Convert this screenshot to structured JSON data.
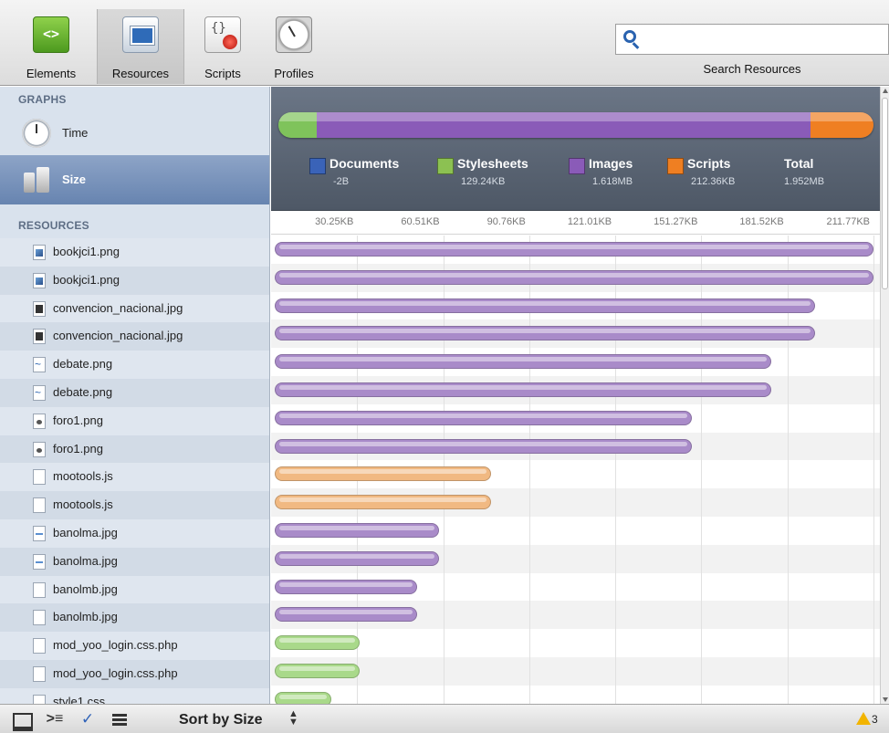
{
  "toolbar": {
    "items": [
      {
        "label": "Elements",
        "icon": "elements-icon"
      },
      {
        "label": "Resources",
        "icon": "resources-icon",
        "selected": true
      },
      {
        "label": "Scripts",
        "icon": "scripts-icon"
      },
      {
        "label": "Profiles",
        "icon": "profiles-icon"
      }
    ],
    "search_label": "Search Resources",
    "search_value": ""
  },
  "sidebar": {
    "graphs_title": "GRAPHS",
    "graphs": [
      {
        "label": "Time",
        "icon": "clock-icon"
      },
      {
        "label": "Size",
        "icon": "weights-icon",
        "selected": true
      }
    ],
    "resources_title": "RESOURCES",
    "resources": [
      {
        "name": "bookjci1.png",
        "icon": "image-icon"
      },
      {
        "name": "bookjci1.png",
        "icon": "image-icon"
      },
      {
        "name": "convencion_nacional.jpg",
        "icon": "image-icon"
      },
      {
        "name": "convencion_nacional.jpg",
        "icon": "image-icon"
      },
      {
        "name": "debate.png",
        "icon": "image-icon"
      },
      {
        "name": "debate.png",
        "icon": "image-icon"
      },
      {
        "name": "foro1.png",
        "icon": "image-icon"
      },
      {
        "name": "foro1.png",
        "icon": "image-icon"
      },
      {
        "name": "mootools.js",
        "icon": "script-file-icon"
      },
      {
        "name": "mootools.js",
        "icon": "script-file-icon"
      },
      {
        "name": "banolma.jpg",
        "icon": "image-icon"
      },
      {
        "name": "banolma.jpg",
        "icon": "image-icon"
      },
      {
        "name": "banolmb.jpg",
        "icon": "image-icon"
      },
      {
        "name": "banolmb.jpg",
        "icon": "image-icon"
      },
      {
        "name": "mod_yoo_login.css.php",
        "icon": "stylesheet-file-icon"
      },
      {
        "name": "mod_yoo_login.css.php",
        "icon": "stylesheet-file-icon"
      },
      {
        "name": "style1.css",
        "icon": "stylesheet-file-icon"
      }
    ]
  },
  "summary": {
    "categories": [
      {
        "name": "Documents",
        "value": "-2B",
        "color": "#3a63b8"
      },
      {
        "name": "Stylesheets",
        "value": "129.24KB",
        "color": "#8cc152"
      },
      {
        "name": "Images",
        "value": "1.618MB",
        "color": "#8a5bb8"
      },
      {
        "name": "Scripts",
        "value": "212.36KB",
        "color": "#ef7f22"
      }
    ],
    "total_label": "Total",
    "total_value": "1.952MB"
  },
  "scale": {
    "ticks": [
      "30.25KB",
      "60.51KB",
      "90.76KB",
      "121.01KB",
      "151.27KB",
      "181.52KB",
      "211.77KB"
    ]
  },
  "chart_data": {
    "type": "bar",
    "orientation": "horizontal",
    "unit": "KB",
    "xlim": [
      0,
      211.77
    ],
    "categories": [
      "bookjci1.png",
      "bookjci1.png",
      "convencion_nacional.jpg",
      "convencion_nacional.jpg",
      "debate.png",
      "debate.png",
      "foro1.png",
      "foro1.png",
      "mootools.js",
      "mootools.js",
      "banolma.jpg",
      "banolma.jpg",
      "banolmb.jpg",
      "banolmb.jpg",
      "mod_yoo_login.css.php",
      "mod_yoo_login.css.php",
      "style1.css"
    ],
    "values": [
      211.77,
      211.77,
      191.0,
      191.0,
      175.5,
      175.5,
      147.5,
      147.5,
      76.5,
      76.5,
      58.0,
      58.0,
      50.5,
      50.5,
      30.0,
      30.0,
      20.0
    ],
    "types": [
      "image",
      "image",
      "image",
      "image",
      "image",
      "image",
      "image",
      "image",
      "script",
      "script",
      "image",
      "image",
      "image",
      "image",
      "stylesheet",
      "stylesheet",
      "stylesheet"
    ],
    "type_colors": {
      "image": "#a98bc9",
      "script": "#f1b982",
      "stylesheet": "#a9d98a"
    },
    "overview": {
      "segments": [
        {
          "type": "Stylesheets",
          "value": 129.24,
          "color": "#7fc35b"
        },
        {
          "type": "Images",
          "value": 1656.8,
          "color": "#8a5bb8"
        },
        {
          "type": "Scripts",
          "value": 212.36,
          "color": "#ef7f22"
        }
      ]
    }
  },
  "status": {
    "sort_label": "Sort by Size",
    "warning_count": "3"
  }
}
